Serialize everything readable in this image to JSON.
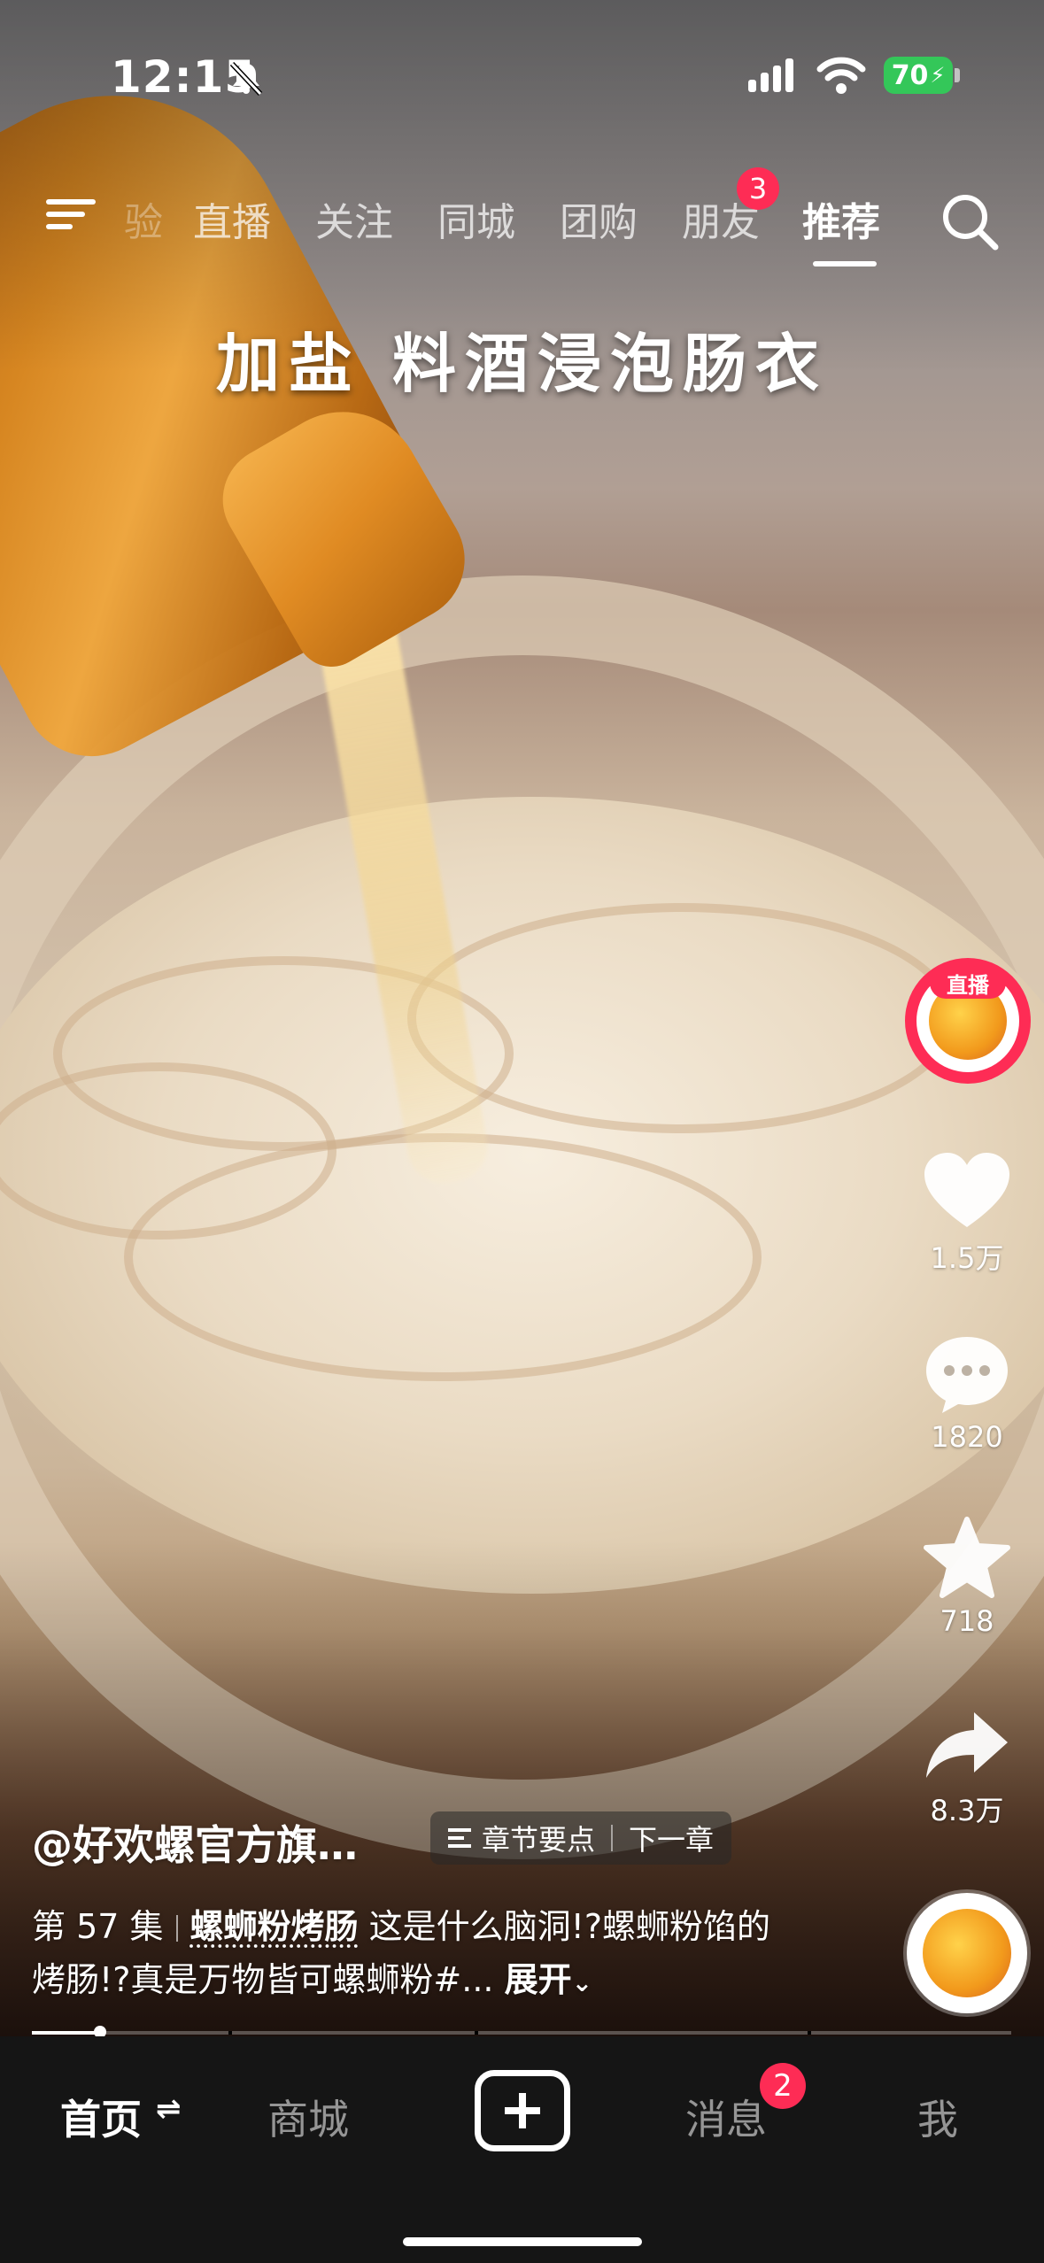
{
  "status_bar": {
    "time": "12:15",
    "battery": "70"
  },
  "top_nav": {
    "tabs": [
      {
        "label": "验"
      },
      {
        "label": "直播"
      },
      {
        "label": "关注"
      },
      {
        "label": "同城"
      },
      {
        "label": "团购"
      },
      {
        "label": "朋友",
        "badge": "3"
      },
      {
        "label": "推荐",
        "active": true
      }
    ]
  },
  "video": {
    "caption": "加盐 料酒浸泡肠衣"
  },
  "right_rail": {
    "live_tag": "直播",
    "likes": "1.5万",
    "comments": "1820",
    "favorites": "718",
    "shares": "8.3万"
  },
  "info": {
    "author": "@好欢螺官方旗…",
    "chapter_points": "章节要点",
    "next_chapter": "下一章",
    "episode": "第 57 集",
    "collection": "螺蛳粉烤肠",
    "description": "这是什么脑洞!?螺蛳粉馅的烤肠!?真是万物皆可螺蛳粉#...",
    "expand": "展开",
    "progress": 0.07
  },
  "tab_bar": {
    "home": "首页",
    "mall": "商城",
    "messages": "消息",
    "messages_badge": "2",
    "me": "我"
  },
  "colors": {
    "accent": "#fe2c55",
    "battery": "#34c759",
    "tabbar_bg": "#151515"
  }
}
